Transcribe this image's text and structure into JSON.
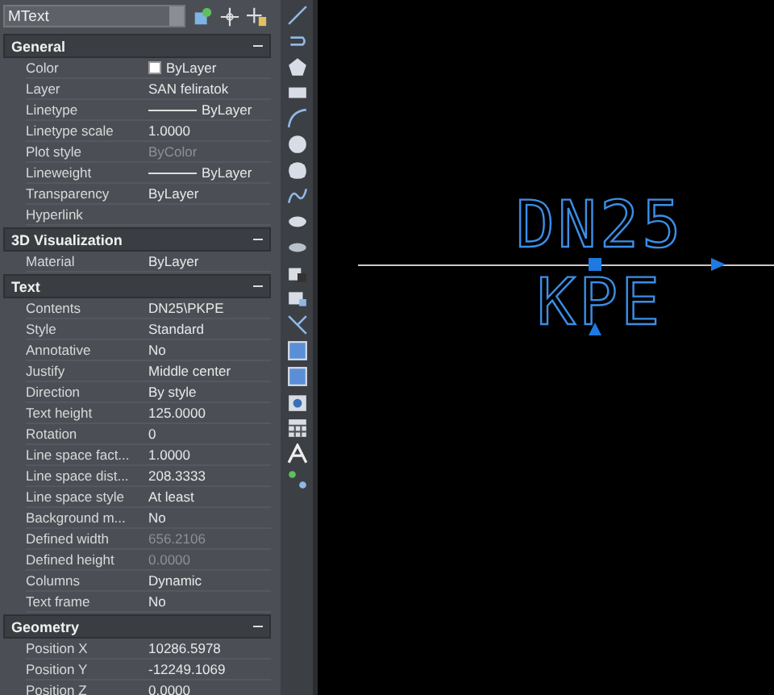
{
  "selector": {
    "value": "MText"
  },
  "sections": [
    {
      "title": "General",
      "expanded": true,
      "rows": [
        {
          "label": "Color",
          "value": "ByLayer",
          "kind": "swatch",
          "disabled": false
        },
        {
          "label": "Layer",
          "value": "SAN feliratok",
          "kind": "text",
          "disabled": false
        },
        {
          "label": "Linetype",
          "value": "ByLayer",
          "kind": "line",
          "disabled": false
        },
        {
          "label": "Linetype scale",
          "value": "1.0000",
          "kind": "text",
          "disabled": false
        },
        {
          "label": "Plot style",
          "value": "ByColor",
          "kind": "text",
          "disabled": true
        },
        {
          "label": "Lineweight",
          "value": "ByLayer",
          "kind": "line",
          "disabled": false
        },
        {
          "label": "Transparency",
          "value": "ByLayer",
          "kind": "text",
          "disabled": false
        },
        {
          "label": "Hyperlink",
          "kind": "text"
        }
      ]
    },
    {
      "title": "3D Visualization",
      "expanded": true,
      "rows": [
        {
          "label": "Material",
          "value": "ByLayer",
          "kind": "text",
          "disabled": false
        }
      ]
    },
    {
      "title": "Text",
      "expanded": true,
      "rows": [
        {
          "label": "Contents",
          "value": "DN25\\PKPE",
          "kind": "text",
          "disabled": false
        },
        {
          "label": "Style",
          "value": "Standard",
          "kind": "text",
          "disabled": false
        },
        {
          "label": "Annotative",
          "value": "No",
          "kind": "text",
          "disabled": false
        },
        {
          "label": "Justify",
          "value": "Middle center",
          "kind": "text",
          "disabled": false
        },
        {
          "label": "Direction",
          "value": "By style",
          "kind": "text",
          "disabled": false
        },
        {
          "label": "Text height",
          "value": "125.0000",
          "kind": "text",
          "disabled": false
        },
        {
          "label": "Rotation",
          "value": "0",
          "kind": "text",
          "disabled": false
        },
        {
          "label": "Line space fact...",
          "value": "1.0000",
          "kind": "text",
          "disabled": false
        },
        {
          "label": "Line space dist...",
          "value": "208.3333",
          "kind": "text",
          "disabled": false
        },
        {
          "label": "Line space style",
          "value": "At least",
          "kind": "text",
          "disabled": false
        },
        {
          "label": "Background  m...",
          "value": "No",
          "kind": "text",
          "disabled": false
        },
        {
          "label": "Defined width",
          "value": "656.2106",
          "kind": "text",
          "disabled": true
        },
        {
          "label": "Defined height",
          "value": "0.0000",
          "kind": "text",
          "disabled": true
        },
        {
          "label": "Columns",
          "value": "Dynamic",
          "kind": "text",
          "disabled": false
        },
        {
          "label": "Text frame",
          "value": "No",
          "kind": "text",
          "disabled": false
        }
      ]
    },
    {
      "title": "Geometry",
      "expanded": true,
      "rows": [
        {
          "label": "Position X",
          "value": "10286.5978",
          "kind": "text",
          "disabled": false
        },
        {
          "label": "Position Y",
          "value": "-12249.1069",
          "kind": "text",
          "disabled": false
        },
        {
          "label": "Position Z",
          "value": "0.0000",
          "kind": "text",
          "disabled": false
        }
      ]
    }
  ],
  "canvas": {
    "lines": [
      "DN25",
      "KPE"
    ]
  }
}
